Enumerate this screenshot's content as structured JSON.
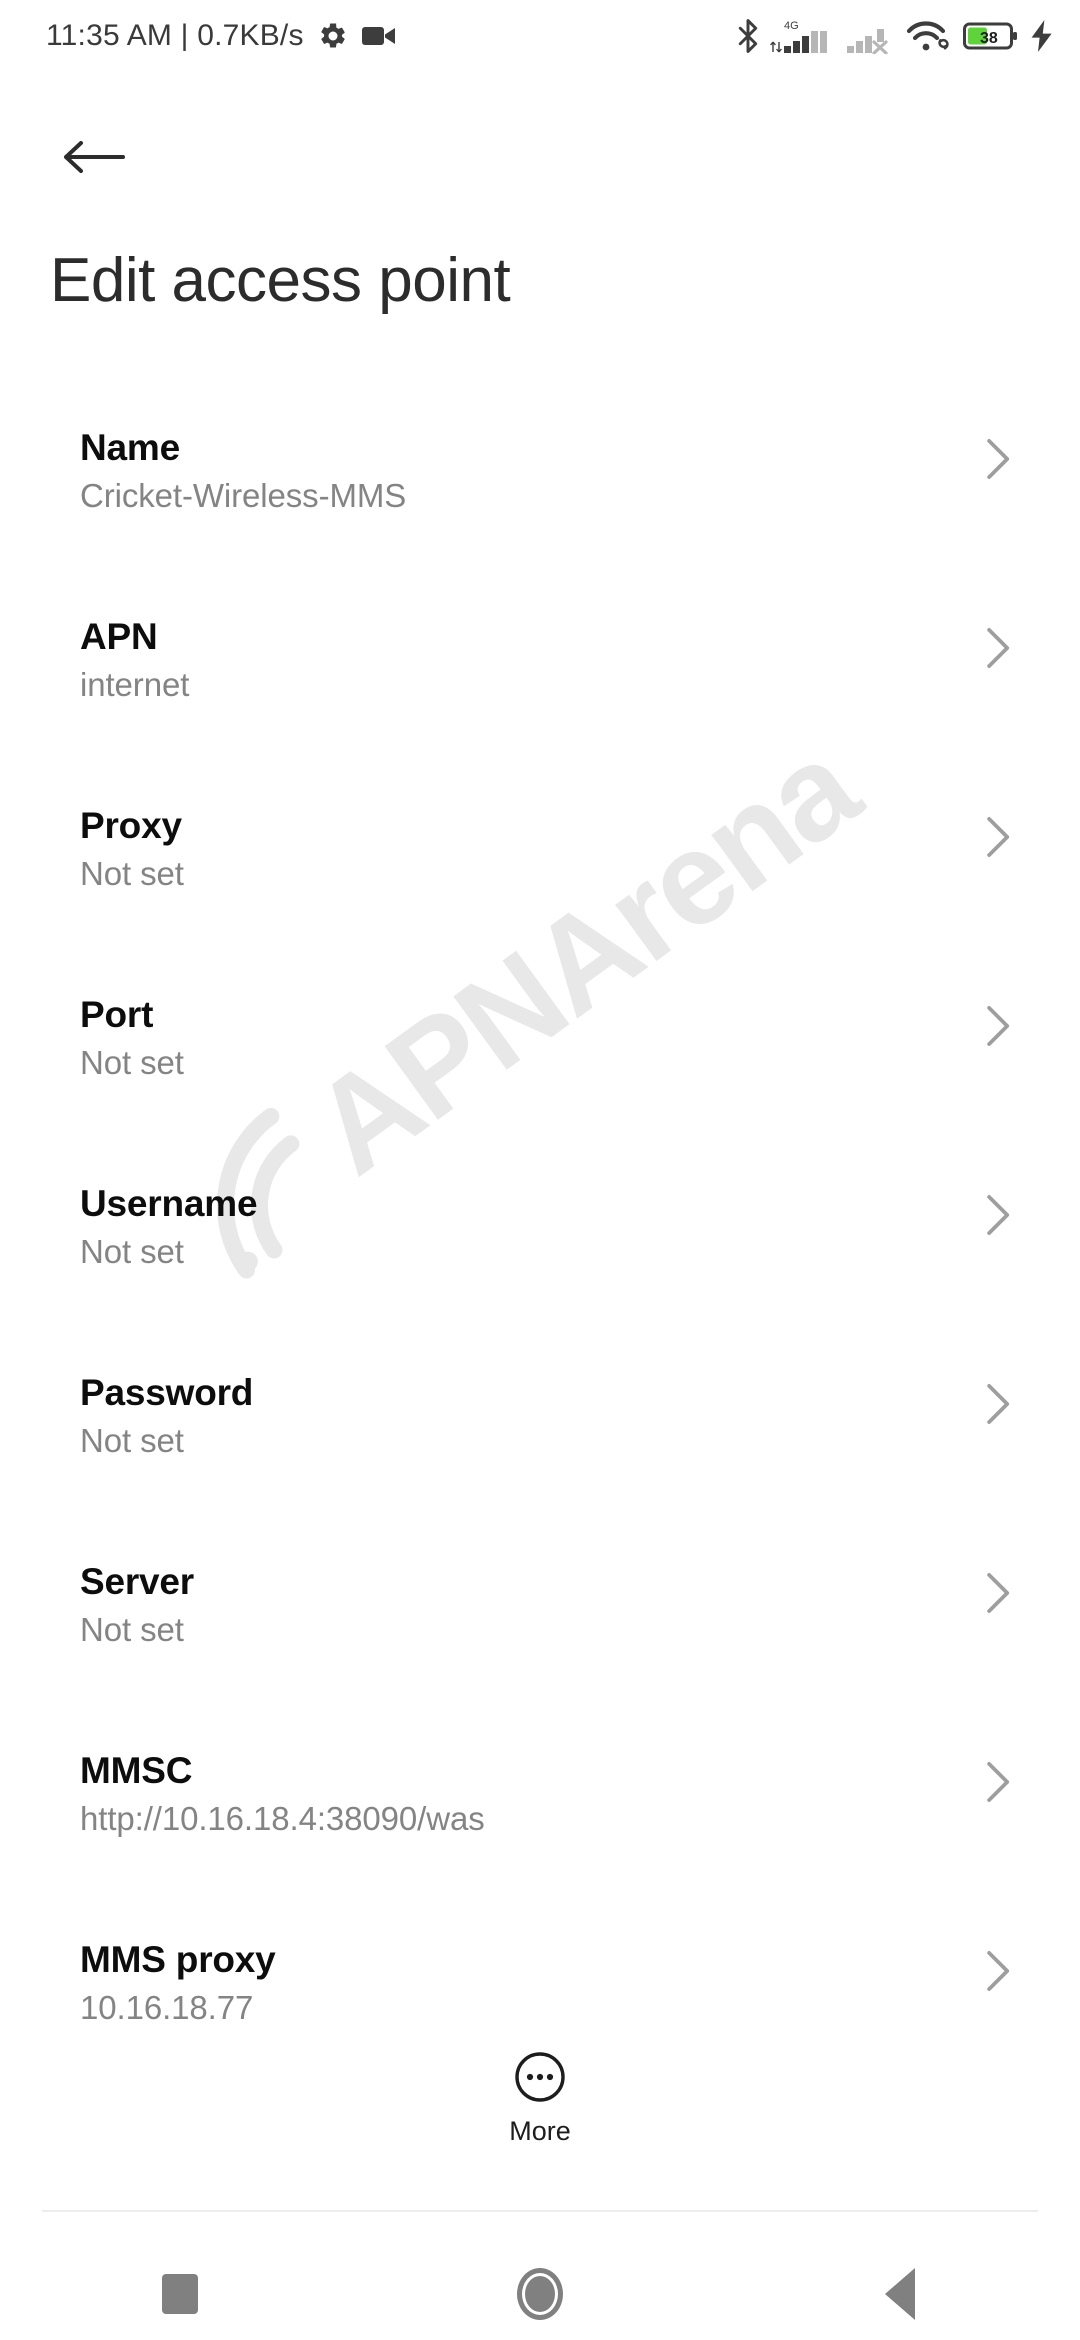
{
  "status_bar": {
    "clock": "11:35 AM | 0.7KB/s",
    "icons_left": [
      "gear-icon",
      "video-camera-icon"
    ],
    "icons_right": [
      "bluetooth-icon",
      "signal-4g-icon",
      "signal-no-service-icon",
      "wifi-icon",
      "battery-icon",
      "charging-bolt-icon"
    ],
    "network_label": "4G",
    "battery_percent": "38",
    "battery_fill_color": "#5fd43a",
    "icon_color": "#3d3d3d",
    "signal_dim_color": "#b6b6b6"
  },
  "header": {
    "back_label": "Back",
    "title": "Edit access point"
  },
  "watermark": {
    "text": "APNArena",
    "color": "#e8e8e8"
  },
  "settings_rows": [
    {
      "title": "Name",
      "value": "Cricket-Wireless-MMS"
    },
    {
      "title": "APN",
      "value": "internet"
    },
    {
      "title": "Proxy",
      "value": "Not set"
    },
    {
      "title": "Port",
      "value": "Not set"
    },
    {
      "title": "Username",
      "value": "Not set"
    },
    {
      "title": "Password",
      "value": "Not set"
    },
    {
      "title": "Server",
      "value": "Not set"
    },
    {
      "title": "MMSC",
      "value": "http://10.16.18.4:38090/was"
    },
    {
      "title": "MMS proxy",
      "value": "10.16.18.77"
    }
  ],
  "more_button": {
    "label": "More",
    "icon": "overflow-dots-circle-icon"
  },
  "nav_bar": {
    "recents_label": "Recents",
    "home_label": "Home",
    "back_label": "Back"
  },
  "colors": {
    "background": "#ffffff",
    "title_text": "#2c2c2c",
    "row_title_text": "#0d0d0d",
    "row_value_text": "#848484",
    "chevron": "#9e9e9e",
    "divider": "#ededed",
    "nav_icon": "#808080"
  }
}
